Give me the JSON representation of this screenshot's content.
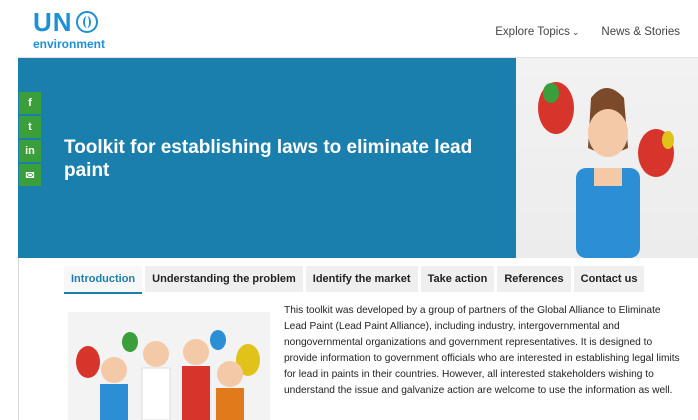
{
  "logo": {
    "un": "UN",
    "environment": "environment"
  },
  "nav": {
    "explore": "Explore Topics",
    "news": "News & Stories"
  },
  "hero": {
    "title": "Toolkit for establishing laws to eliminate lead paint",
    "color": "#1b7fae"
  },
  "share": {
    "facebook": "f",
    "twitter": "t",
    "linkedin": "in",
    "email": "✉"
  },
  "tabs": [
    "Introduction",
    "Understanding the problem",
    "Identify the market",
    "Take action",
    "References",
    "Contact us"
  ],
  "content": {
    "paragraph": "This toolkit was developed by a group of partners of the Global Alliance to Eliminate Lead Paint (Lead Paint Alliance), including industry, intergovernmental and nongovernmental organizations and government representatives. It is designed to provide information to government officials who are interested in establishing legal limits for lead in paints in their countries. However, all interested stakeholders wishing to understand the issue and galvanize action are welcome to use the information as well."
  }
}
